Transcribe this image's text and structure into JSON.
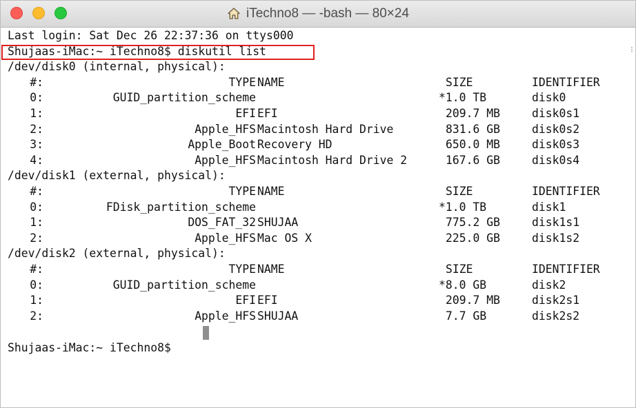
{
  "window": {
    "title": "iTechno8 — -bash — 80×24",
    "title_icon": "home-icon",
    "traffic_lights": {
      "close": "#fc5f57",
      "minimize": "#fdbc2e",
      "maximize": "#28c840"
    }
  },
  "terminal": {
    "last_login": "Last login: Sat Dec 26 22:37:36 on ttys000",
    "prompt": "Shujaas-iMac:~ iTechno8$",
    "command": "diskutil list",
    "header": {
      "num": "#:",
      "type": "TYPE",
      "name": "NAME",
      "size": "SIZE",
      "identifier": "IDENTIFIER"
    },
    "disks": [
      {
        "device": "/dev/disk0 (internal, physical):",
        "rows": [
          {
            "num": "0:",
            "type": "GUID_partition_scheme",
            "name": "",
            "size": "*1.0 TB",
            "identifier": "disk0"
          },
          {
            "num": "1:",
            "type": "EFI",
            "name": "EFI",
            "size": "209.7 MB",
            "identifier": "disk0s1"
          },
          {
            "num": "2:",
            "type": "Apple_HFS",
            "name": "Macintosh Hard Drive",
            "size": "831.6 GB",
            "identifier": "disk0s2"
          },
          {
            "num": "3:",
            "type": "Apple_Boot",
            "name": "Recovery HD",
            "size": "650.0 MB",
            "identifier": "disk0s3"
          },
          {
            "num": "4:",
            "type": "Apple_HFS",
            "name": "Macintosh Hard Drive 2",
            "size": "167.6 GB",
            "identifier": "disk0s4"
          }
        ]
      },
      {
        "device": "/dev/disk1 (external, physical):",
        "rows": [
          {
            "num": "0:",
            "type": "FDisk_partition_scheme",
            "name": "",
            "size": "*1.0 TB",
            "identifier": "disk1"
          },
          {
            "num": "1:",
            "type": "DOS_FAT_32",
            "name": "SHUJAA",
            "size": "775.2 GB",
            "identifier": "disk1s1"
          },
          {
            "num": "2:",
            "type": "Apple_HFS",
            "name": "Mac OS X",
            "size": "225.0 GB",
            "identifier": "disk1s2"
          }
        ]
      },
      {
        "device": "/dev/disk2 (external, physical):",
        "rows": [
          {
            "num": "0:",
            "type": "GUID_partition_scheme",
            "name": "",
            "size": "*8.0 GB",
            "identifier": "disk2"
          },
          {
            "num": "1:",
            "type": "EFI",
            "name": "EFI",
            "size": "209.7 MB",
            "identifier": "disk2s1"
          },
          {
            "num": "2:",
            "type": "Apple_HFS",
            "name": "SHUJAA",
            "size": "7.7 GB",
            "identifier": "disk2s2"
          }
        ]
      }
    ],
    "final_prompt": "Shujaas-iMac:~ iTechno8$",
    "highlight_color": "#e02020"
  }
}
